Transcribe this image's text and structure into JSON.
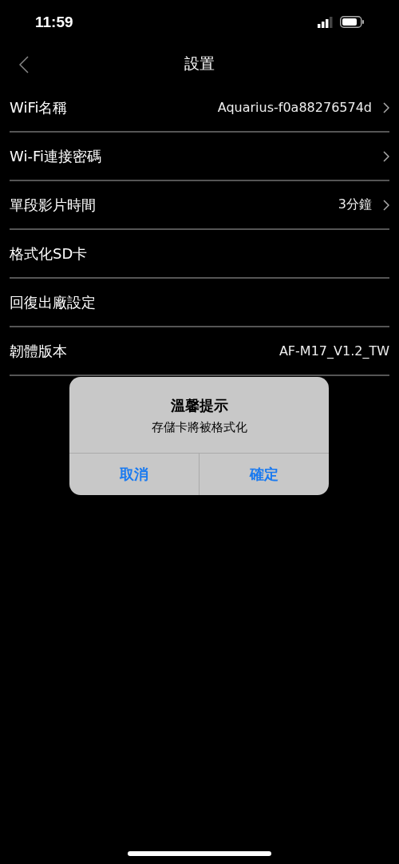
{
  "status_bar": {
    "time": "11:59"
  },
  "nav": {
    "title": "設置"
  },
  "rows": [
    {
      "label": "WiFi名稱",
      "value": "Aquarius-f0a88276574d",
      "chevron": true
    },
    {
      "label": "Wi-Fi連接密碼",
      "chevron": true
    },
    {
      "label": "單段影片時間",
      "value": "3分鐘",
      "chevron": true
    },
    {
      "label": "格式化SD卡",
      "chevron": false
    },
    {
      "label": "回復出廠設定",
      "chevron": false
    },
    {
      "label": "韌體版本",
      "value": "AF-M17_V1.2_TW",
      "chevron": false
    }
  ],
  "dialog": {
    "title": "溫馨提示",
    "message": "存儲卡將被格式化",
    "buttons": [
      "取消",
      "確定"
    ]
  }
}
